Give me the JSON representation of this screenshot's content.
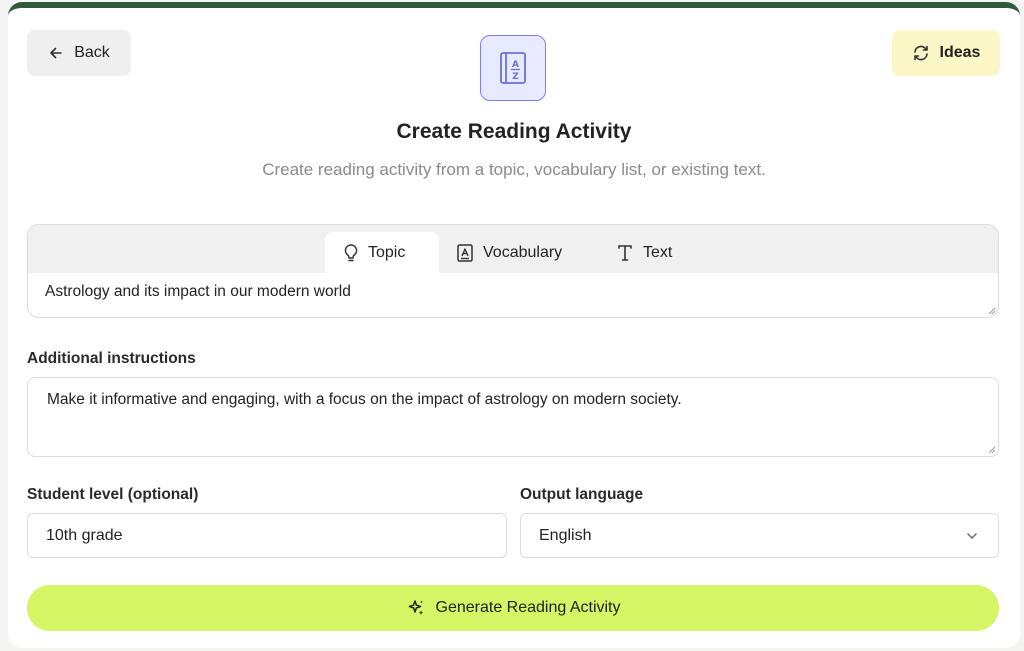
{
  "header": {
    "back_label": "Back",
    "ideas_label": "Ideas",
    "logo_icon": "az-book-icon"
  },
  "page": {
    "title": "Create Reading Activity",
    "subtitle": "Create reading activity from a topic, vocabulary list, or existing text."
  },
  "source_tabs": {
    "active": "Topic",
    "items": [
      {
        "label": "Topic",
        "icon": "lightbulb-icon"
      },
      {
        "label": "Vocabulary",
        "icon": "vocabulary-book-icon"
      },
      {
        "label": "Text",
        "icon": "text-t-icon"
      }
    ],
    "topic_value": "Astrology and its impact in our modern world"
  },
  "instructions": {
    "label": "Additional instructions",
    "value": "Make it informative and engaging, with a focus on the impact of astrology on modern society."
  },
  "student_level": {
    "label": "Student level (optional)",
    "value": "10th grade"
  },
  "output_language": {
    "label": "Output language",
    "value": "English"
  },
  "generate": {
    "label": "Generate Reading Activity",
    "icon": "sparkles-icon"
  },
  "colors": {
    "accent_green": "#d6f565",
    "ideas_yellow": "#fbf7c6",
    "logo_blue": "#7b7ff0",
    "top_border": "#2f5a3e"
  }
}
